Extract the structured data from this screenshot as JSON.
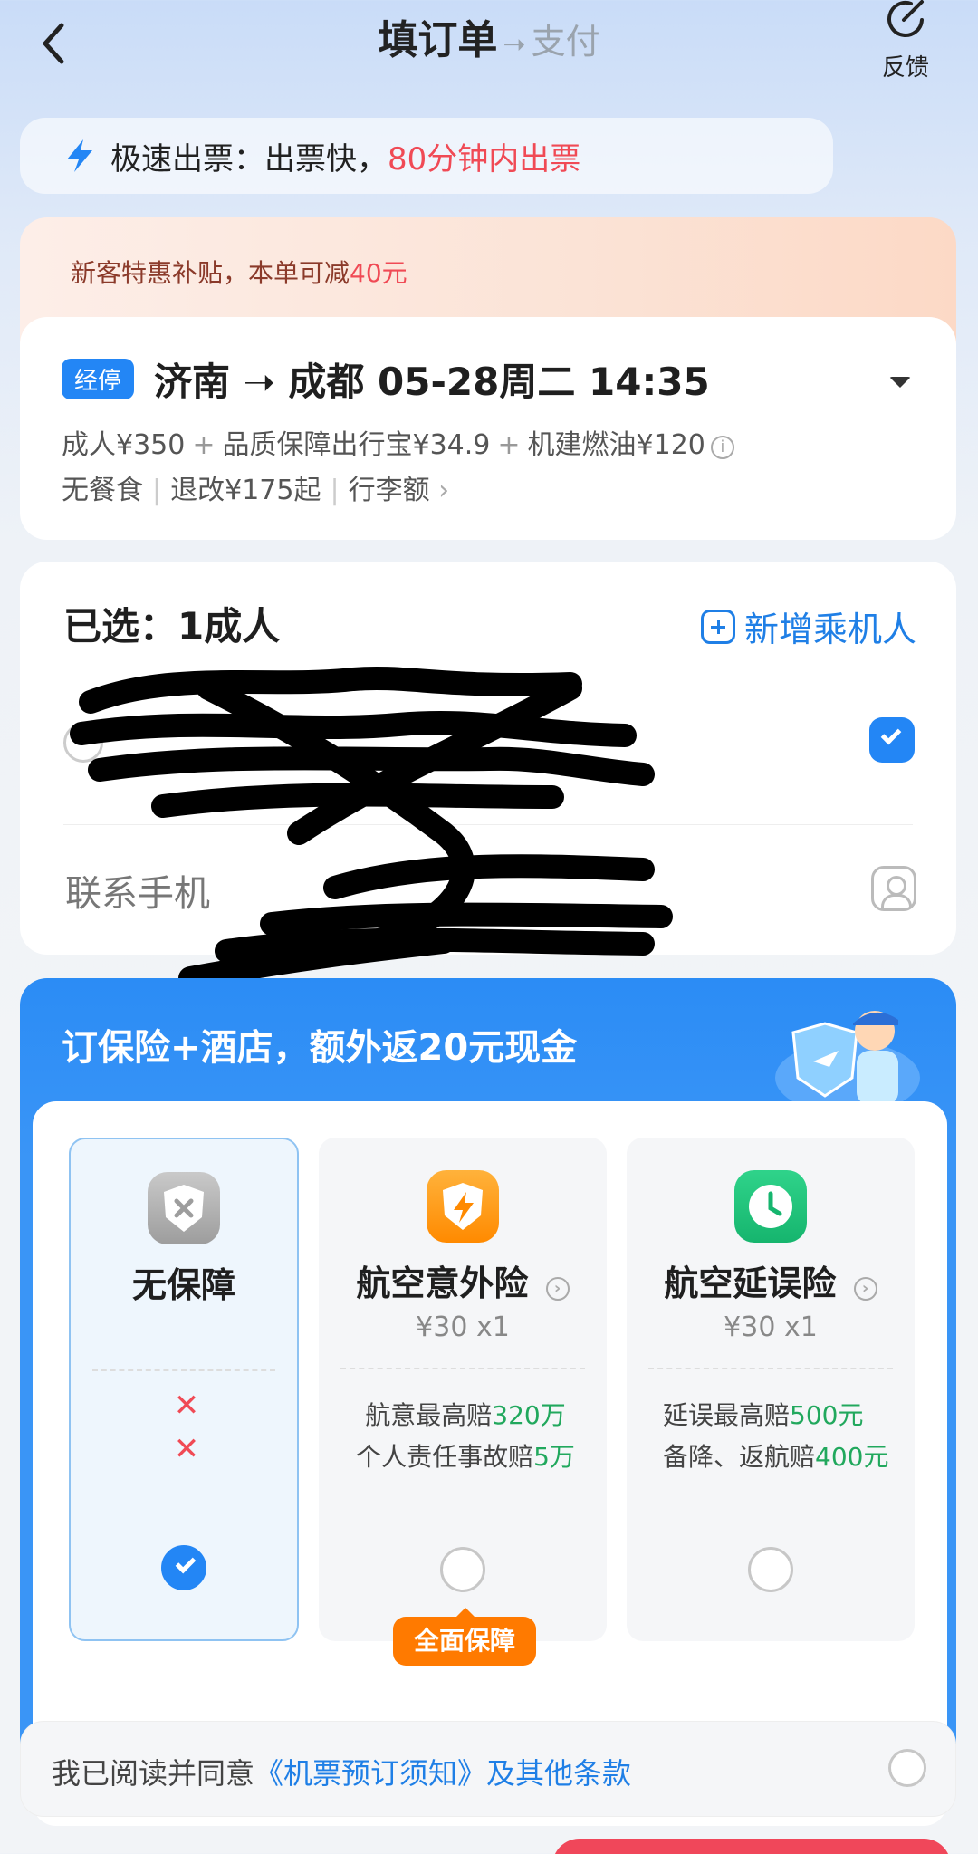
{
  "header": {
    "title": "填订单",
    "arrow": "➝",
    "next_step": "支付",
    "feedback_label": "反馈"
  },
  "fast_ticket": {
    "label": "极速出票：出票快，",
    "highlight": "80分钟内出票"
  },
  "promo": {
    "text": "新客特惠补贴，本单可减",
    "amount": "40元"
  },
  "flight": {
    "badge": "经停",
    "route": "济南 ➝ 成都  05-28周二 14:35",
    "adult_price": "成人¥350",
    "insurance_price": "品质保障出行宝¥34.9",
    "tax_price": "机建燃油¥120",
    "plus": "+",
    "meal": "无餐食",
    "refund": "退改¥175起",
    "baggage": "行李额",
    "chevron": "›",
    "info_glyph": "i"
  },
  "passengers": {
    "selected": "已选：1成人",
    "add_label": "新增乘机人",
    "phone_label": "联系手机"
  },
  "insurance": {
    "headline": "订保险+酒店，额外返20元现金",
    "options": [
      {
        "name": "无保障",
        "x_mark": "✕"
      },
      {
        "name": "航空意外险",
        "price": "¥30 x1",
        "line1_pre": "航意最高赔",
        "line1_val": "320万",
        "line2_pre": "个人责任事故赔",
        "line2_val": "5万"
      },
      {
        "name": "航空延误险",
        "price": "¥30 x1",
        "line1_pre": "延误最高赔",
        "line1_val": "500元",
        "line2_pre": "备降、返航赔",
        "line2_val": "400元"
      }
    ],
    "full_badge": "全面保障"
  },
  "agreement": {
    "prefix": "我已阅读并同意",
    "link": "《机票预订须知》及其他条款"
  },
  "colors": {
    "accent": "#2386f5",
    "alert": "#f04a55",
    "green": "#21a85d",
    "orange": "#ff7a00"
  }
}
